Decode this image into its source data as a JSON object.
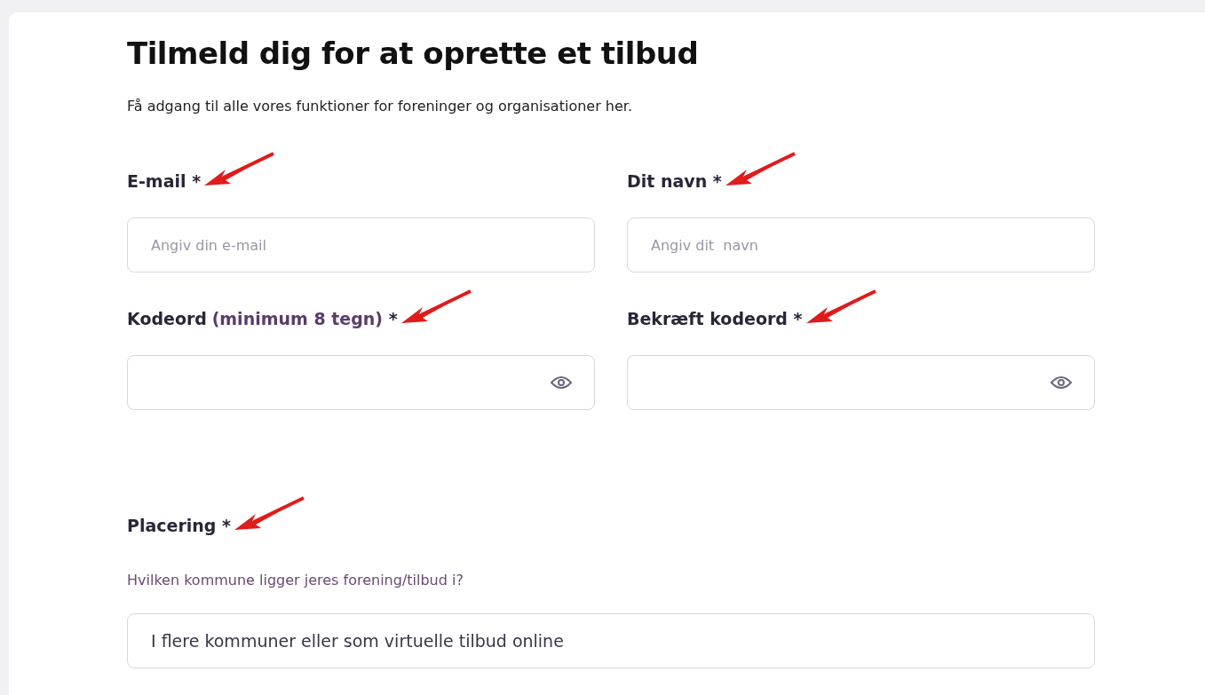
{
  "title": "Tilmeld dig for at oprette et tilbud",
  "subtitle": "Få adgang til alle vores funktioner for foreninger og organisationer her.",
  "fields": [
    {
      "kind": "text",
      "label": "E-mail",
      "required": "*",
      "marked": true,
      "placeholder": "Angiv din e-mail"
    },
    {
      "kind": "text",
      "label": "Dit navn",
      "required": "*",
      "marked": true,
      "placeholder": "Angiv dit  navn"
    },
    {
      "kind": "password",
      "label": "Kodeord",
      "note": "(minimum 8 tegn)",
      "required": "*",
      "marked": true
    },
    {
      "kind": "password",
      "label": "Bekræft kodeord",
      "required": "*",
      "marked": true
    }
  ],
  "location": {
    "label": "Placering",
    "required": "*",
    "marked": true,
    "hint": "Hvilken kommune ligger jeres forening/tilbud i?",
    "value": "I flere kommuner eller som virtuelle tilbud online"
  }
}
